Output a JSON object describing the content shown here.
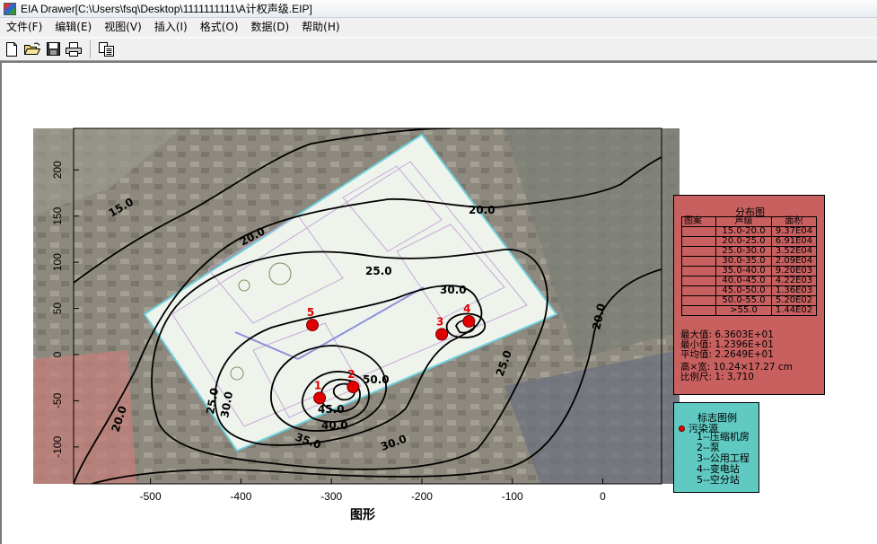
{
  "window": {
    "title": "EIA Drawer[C:\\Users\\fsq\\Desktop\\1111111111\\A计权声级.EIP]"
  },
  "menu": [
    "文件(F)",
    "编辑(E)",
    "视图(V)",
    "插入(I)",
    "格式(O)",
    "数据(D)",
    "帮助(H)"
  ],
  "toolbar": {
    "icons": [
      "new-file-icon",
      "open-folder-icon",
      "save-icon",
      "print-icon",
      "copy-icon"
    ]
  },
  "chart_data": {
    "type": "contour",
    "xlabel": "图形",
    "x_ticks": [
      -500,
      -400,
      -300,
      -200,
      -100,
      0
    ],
    "y_ticks": [
      200,
      150,
      100,
      50,
      0,
      -50,
      -100
    ],
    "xlim": [
      -585,
      65
    ],
    "ylim": [
      -140,
      245
    ],
    "contour_levels": [
      15.0,
      20.0,
      25.0,
      30.0,
      35.0,
      40.0,
      45.0,
      50.0
    ],
    "contour_labels": [
      "15.0",
      "20.0",
      "20.0",
      "20.0",
      "20.0",
      "25.0",
      "25.0",
      "25.0",
      "30.0",
      "30.0",
      "30.0",
      "35.0",
      "40.0",
      "45.0",
      "50.0"
    ],
    "sources": [
      {
        "id": "1",
        "x": -313,
        "y": -47
      },
      {
        "id": "2",
        "x": -276,
        "y": -35
      },
      {
        "id": "3",
        "x": -178,
        "y": 22
      },
      {
        "id": "4",
        "x": -148,
        "y": 36
      },
      {
        "id": "5",
        "x": -321,
        "y": 32
      }
    ]
  },
  "distribution": {
    "title": "分布图",
    "headers": [
      "图案",
      "声级",
      "面积"
    ],
    "rows": [
      {
        "pattern": "",
        "level": "15.0-20.0",
        "area": "9.37E04"
      },
      {
        "pattern": "",
        "level": "20.0-25.0",
        "area": "6.91E04"
      },
      {
        "pattern": "",
        "level": "25.0-30.0",
        "area": "3.52E04"
      },
      {
        "pattern": "",
        "level": "30.0-35.0",
        "area": "2.09E04"
      },
      {
        "pattern": "",
        "level": "35.0-40.0",
        "area": "9.20E03"
      },
      {
        "pattern": "",
        "level": "40.0-45.0",
        "area": "4.22E03"
      },
      {
        "pattern": "",
        "level": "45.0-50.0",
        "area": "1.36E03"
      },
      {
        "pattern": "",
        "level": "50.0-55.0",
        "area": "5.20E02"
      },
      {
        "pattern": "",
        "level": ">55.0",
        "area": "1.44E02"
      }
    ],
    "stats": [
      "最大值: 6.3603E+01",
      "最小值: 1.2396E+01",
      "平均值: 2.2649E+01",
      "高×宽: 10.24×17.27 cm",
      "比例尺: 1: 3,710"
    ]
  },
  "markers": {
    "title": "标志图例",
    "source_label": "污染源",
    "items": [
      "1--压缩机房",
      "2--泵",
      "3--公用工程",
      "4--变电站",
      "5--空分站"
    ]
  },
  "colors": {
    "source": "#e00000",
    "legend_bg": "#c86060",
    "marker_bg": "#5fc9c2",
    "contour": "#000000"
  }
}
